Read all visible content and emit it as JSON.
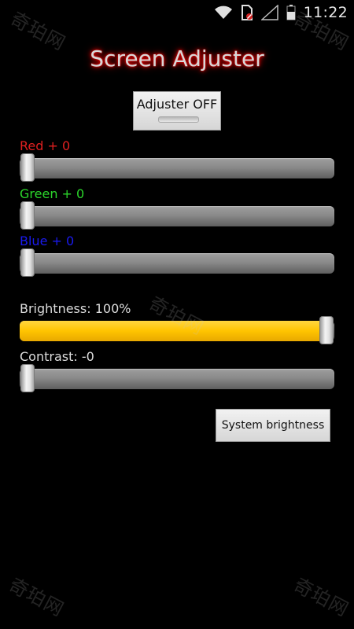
{
  "status_bar": {
    "time": "11:22",
    "icons": [
      "wifi-icon",
      "sim-card-icon",
      "signal-icon",
      "battery-icon"
    ]
  },
  "app": {
    "title": "Screen Adjuster"
  },
  "toggle": {
    "label": "Adjuster OFF",
    "state": "off"
  },
  "sliders": {
    "red": {
      "label": "Red + 0",
      "value_percent": 0,
      "color": "#e02020"
    },
    "green": {
      "label": "Green + 0",
      "value_percent": 0,
      "color": "#2bd62b"
    },
    "blue": {
      "label": "Blue + 0",
      "value_percent": 0,
      "color": "#1a1aee"
    },
    "brightness": {
      "label": "Brightness: 100%",
      "value_percent": 100,
      "color": "#dddddd",
      "fill_color": "#ffc400"
    },
    "contrast": {
      "label": "Contrast: -0",
      "value_percent": 0,
      "color": "#dddddd"
    }
  },
  "buttons": {
    "system_brightness": "System brightness"
  },
  "watermark": {
    "text": "奇珀网"
  },
  "colors": {
    "background": "#000000",
    "title_glow": "#ff0000",
    "track": "#8a8a8a"
  }
}
